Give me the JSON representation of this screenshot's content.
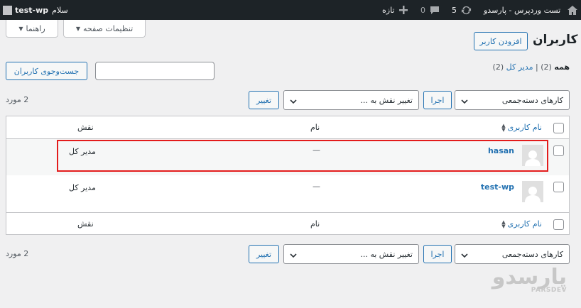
{
  "admin_bar": {
    "greeting": "سلام",
    "username": "test-wp",
    "new_label": "تازه",
    "comments_count": "0",
    "updates_count": "5",
    "site_name": "تست وردپرس - پارسدو",
    "icons": [
      "avatar",
      "plus-icon",
      "comment-icon",
      "updates-icon",
      "home-icon"
    ]
  },
  "top_tabs": {
    "help": "راهنما",
    "screen_options": "تنظیمات صفحه"
  },
  "page": {
    "title": "کاربران",
    "add_new": "افزودن کاربر",
    "search_button": "جست‌وجوی کاربران",
    "search_placeholder": ""
  },
  "views": {
    "all_label": "همه",
    "all_count": "(2)",
    "separator": "|",
    "admin_label": "مدیر کل",
    "admin_count": "(2)"
  },
  "actions": {
    "bulk_label": "کارهای دسته‌جمعی",
    "apply": "اجرا",
    "role_label": "تغییر نقش به ...",
    "change": "تغییر",
    "count": "2 مورد"
  },
  "table": {
    "columns": {
      "username": "نام کاربری",
      "name": "نام",
      "role": "نقش"
    },
    "rows": [
      {
        "username": "hasan",
        "name": "—",
        "role": "مدیر کل"
      },
      {
        "username": "test-wp",
        "name": "—",
        "role": "مدیر کل"
      }
    ]
  },
  "watermark": {
    "fa": "پارسدو",
    "en": "PARSDEV"
  },
  "colors": {
    "accent": "#2271b1",
    "admin_bar": "#1d2327",
    "highlight": "#e31c1c"
  }
}
